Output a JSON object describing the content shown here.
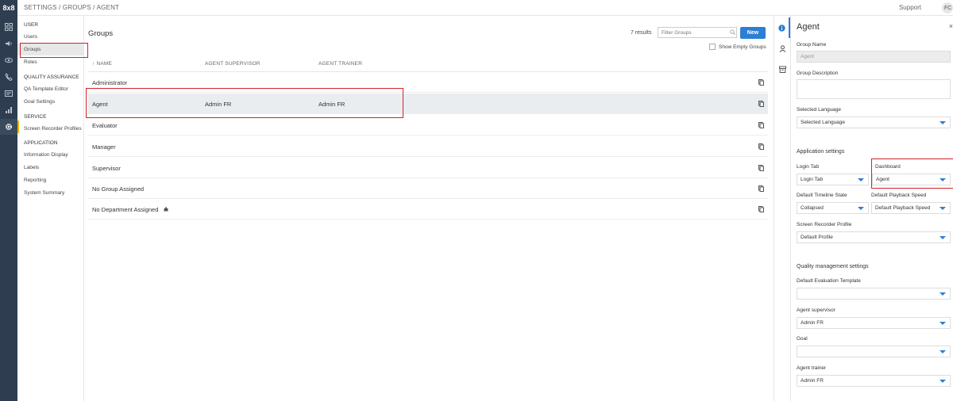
{
  "app": {
    "logo": "8x8"
  },
  "topbar": {
    "breadcrumb": "SETTINGS / GROUPS / AGENT",
    "support": "Support",
    "avatar": "FC"
  },
  "settings_nav": {
    "sections": [
      {
        "title": "USER",
        "items": [
          "Users",
          "Groups",
          "Roles"
        ]
      },
      {
        "title": "QUALITY ASSURANCE",
        "items": [
          "QA Template Editor",
          "Goal Settings"
        ]
      },
      {
        "title": "SERVICE",
        "items": [
          "Screen Recorder Profiles"
        ]
      },
      {
        "title": "APPLICATION",
        "items": [
          "Information Display",
          "Labels",
          "Reporting",
          "System Summary"
        ]
      }
    ],
    "selected": "Groups"
  },
  "main": {
    "title": "Groups",
    "results": "7 results",
    "filter_placeholder": "Filter Groups",
    "new_label": "New",
    "show_empty": "Show Empty Groups",
    "columns": [
      "↑ NAME",
      "AGENT SUPERVISOR",
      "AGENT TRAINER"
    ],
    "rows": [
      {
        "name": "Administrator",
        "supervisor": "",
        "trainer": ""
      },
      {
        "name": "Agent",
        "supervisor": "Admin FR",
        "trainer": "Admin FR"
      },
      {
        "name": "Evaluator",
        "supervisor": "",
        "trainer": ""
      },
      {
        "name": "Manager",
        "supervisor": "",
        "trainer": ""
      },
      {
        "name": "Supervisor",
        "supervisor": "",
        "trainer": ""
      },
      {
        "name": "No Group Assigned",
        "supervisor": "",
        "trainer": ""
      },
      {
        "name": "No Department Assigned",
        "supervisor": "",
        "trainer": ""
      }
    ],
    "selected_row": "Agent"
  },
  "panel": {
    "title": "Agent",
    "close": "×",
    "group_name_label": "Group Name",
    "group_name_value": "Agent",
    "group_desc_label": "Group Description",
    "selected_language_label": "Selected Language",
    "selected_language_value": "Selected Language",
    "app_settings": "Application settings",
    "login_tab_label": "Login Tab",
    "login_tab_value": "Login Tab",
    "dashboard_label": "Dashboard",
    "dashboard_value": "Agent",
    "timeline_label": "Default Timeline State",
    "timeline_value": "Collapsed",
    "playback_label": "Default Playback Speed",
    "playback_value": "Default Playback Speed",
    "recorder_label": "Screen Recorder Profile",
    "recorder_value": "Default Profile",
    "qm_settings": "Quality management settings",
    "eval_template_label": "Default Evaluation Template",
    "eval_template_value": "",
    "supervisor_label": "Agent supervisor",
    "supervisor_value": "Admin FR",
    "goal_label": "Goal",
    "goal_value": "",
    "trainer_label": "Agent trainer",
    "trainer_value": "Admin FR"
  },
  "colors": {
    "rail": "#2e3d4f",
    "accent": "#2a7fd4",
    "highlight": "#d0232a",
    "nav_marker": "#f0b400"
  }
}
